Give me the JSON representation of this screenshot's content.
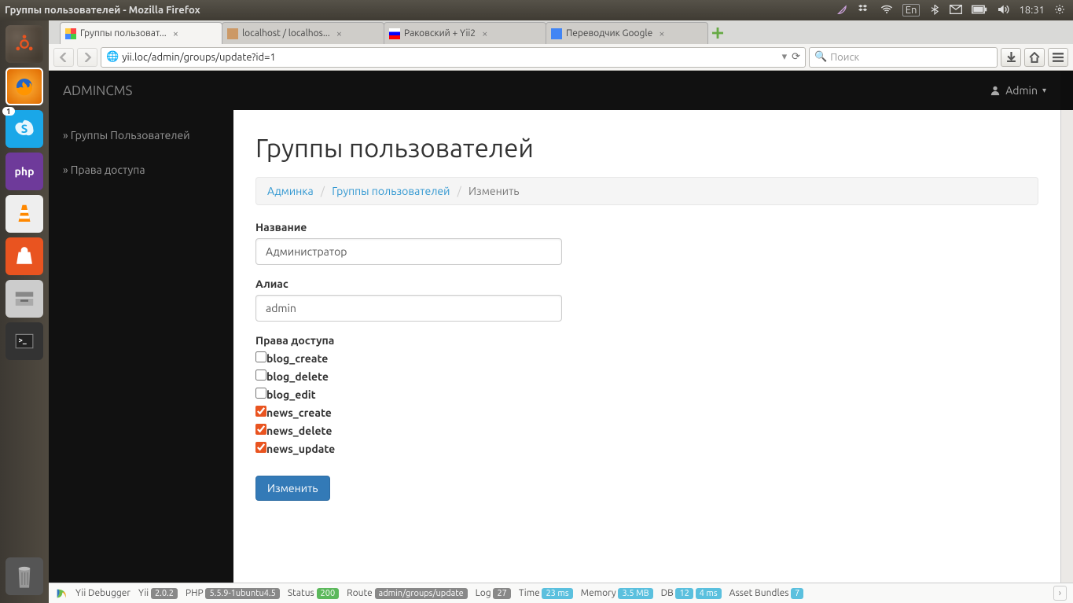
{
  "window_title": "Группы пользователей - Mozilla Firefox",
  "tray": {
    "lang": "En",
    "time": "18:31"
  },
  "launcher_badge": "1",
  "tabs": [
    {
      "label": "Группы пользоват..."
    },
    {
      "label": "localhost / localhos..."
    },
    {
      "label": "Раковский + Yii2"
    },
    {
      "label": "Переводчик Google"
    }
  ],
  "url": "yii.loc/admin/groups/update?id=1",
  "search_placeholder": "Поиск",
  "app": {
    "brand": "ADMINCMS",
    "user": "Admin",
    "sidebar": [
      {
        "label": "» Группы Пользователей"
      },
      {
        "label": "» Права доступа"
      }
    ]
  },
  "page": {
    "title": "Группы пользователей",
    "breadcrumb": {
      "admin": "Админка",
      "groups": "Группы пользователей",
      "current": "Изменить"
    },
    "fields": {
      "name_label": "Название",
      "name_value": "Администратор",
      "alias_label": "Алиас",
      "alias_value": "admin",
      "perms_label": "Права доступа"
    },
    "perms": [
      {
        "label": "blog_create",
        "checked": false
      },
      {
        "label": "blog_delete",
        "checked": false
      },
      {
        "label": "blog_edit",
        "checked": false
      },
      {
        "label": "news_create",
        "checked": true
      },
      {
        "label": "news_delete",
        "checked": true
      },
      {
        "label": "news_update",
        "checked": true
      }
    ],
    "submit": "Изменить"
  },
  "debug": {
    "label": "Yii Debugger",
    "yii": "Yii",
    "yii_v": "2.0.2",
    "php": "PHP",
    "php_v": "5.5.9-1ubuntu4.5",
    "status": "Status",
    "status_v": "200",
    "route": "Route",
    "route_v": "admin/groups/update",
    "log": "Log",
    "log_v": "27",
    "time": "Time",
    "time_v": "23 ms",
    "mem": "Memory",
    "mem_v": "3.5 MB",
    "db": "DB",
    "db_v": "12",
    "db_t": "4 ms",
    "ab": "Asset Bundles",
    "ab_v": "7"
  }
}
